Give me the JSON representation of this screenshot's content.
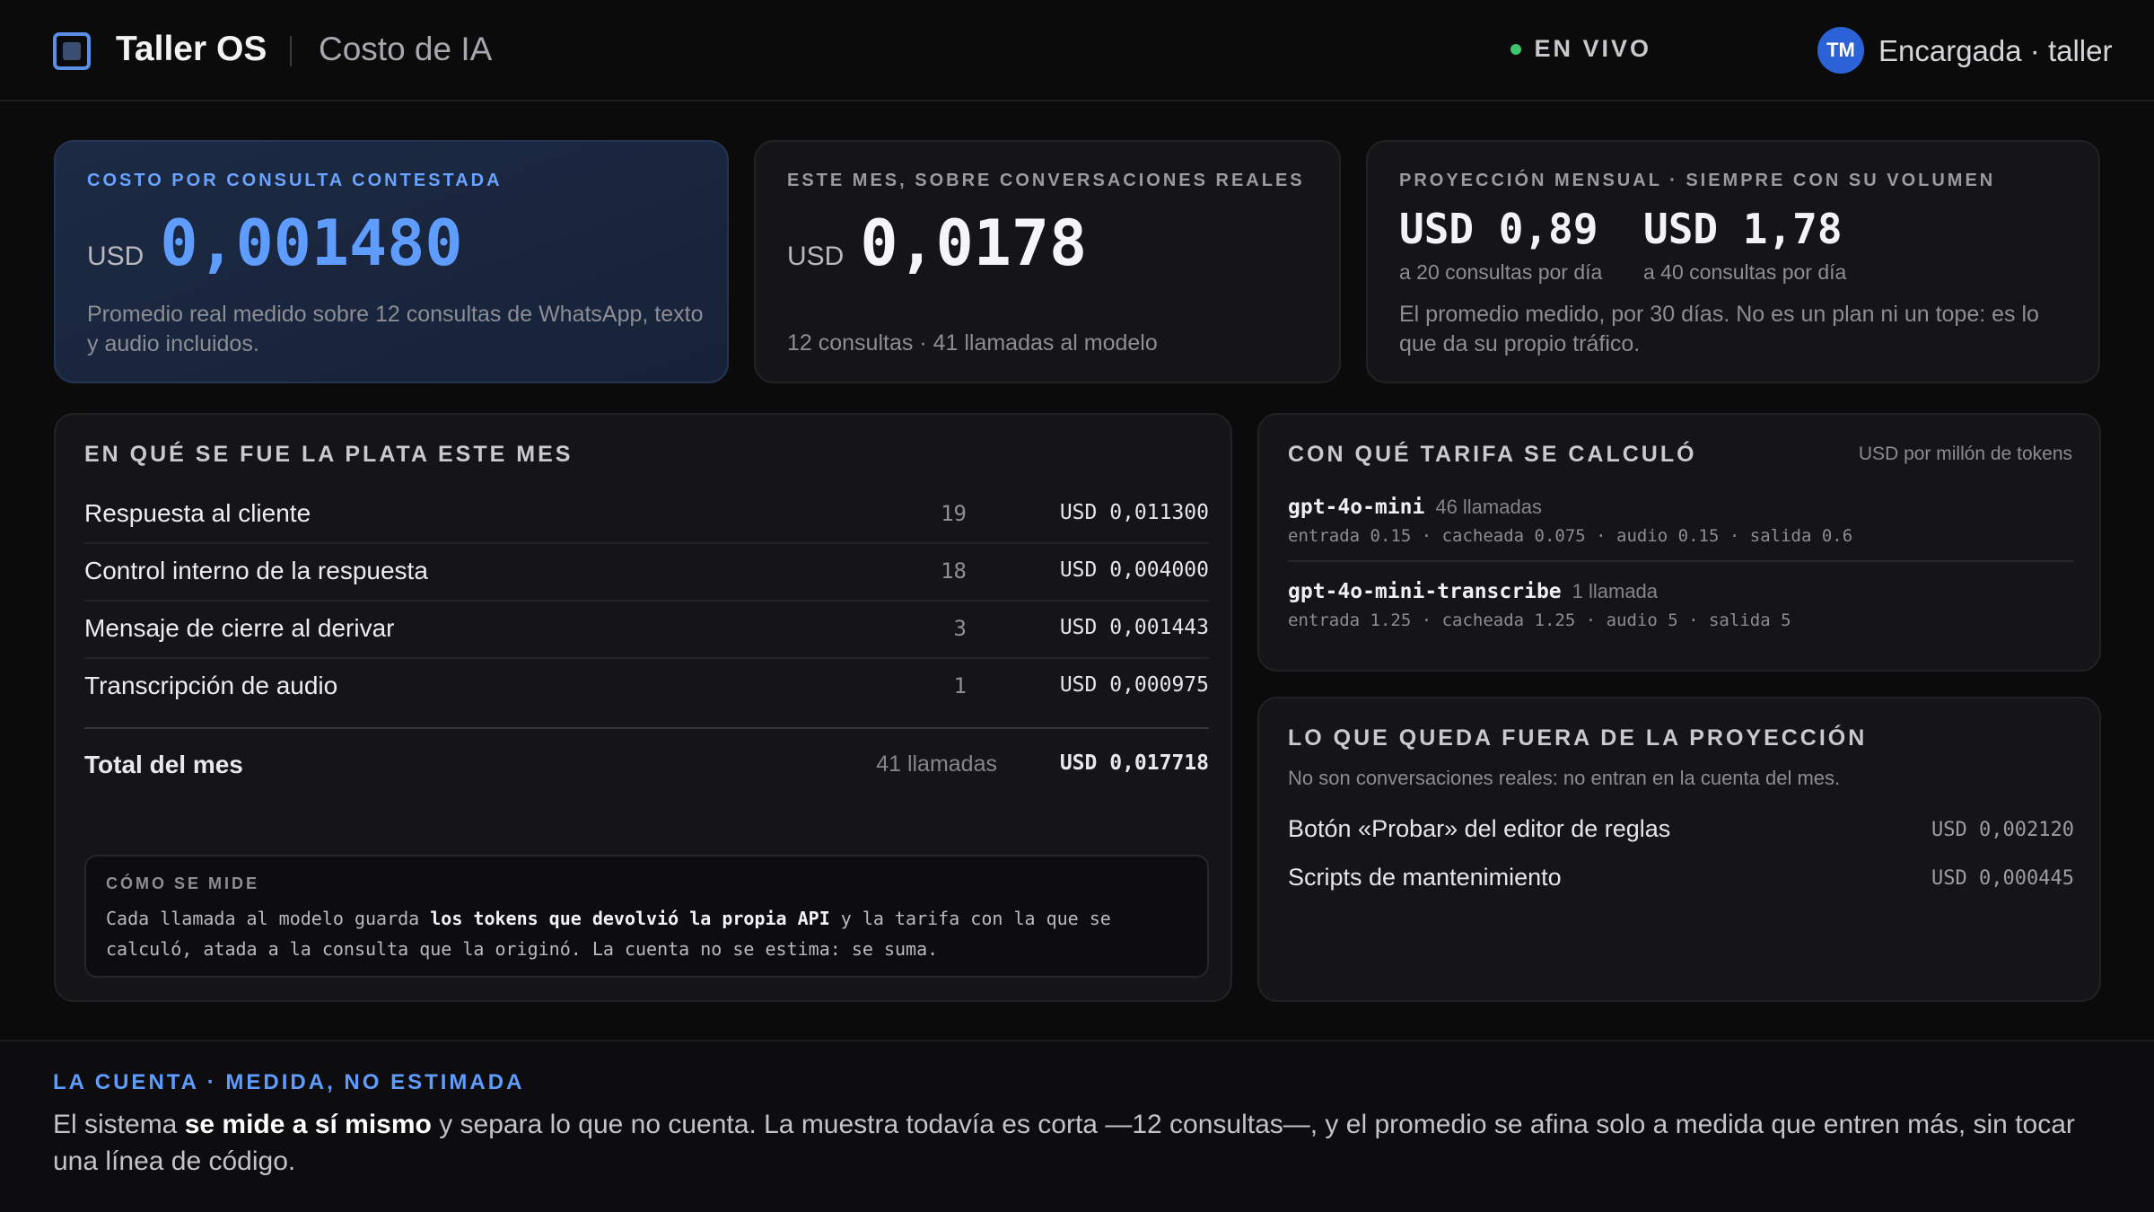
{
  "header": {
    "brand": "Taller OS",
    "section": "Costo de IA",
    "live": "EN VIVO",
    "avatar_initials": "TM",
    "user": "Encargada · taller"
  },
  "stats": [
    {
      "kicker": "COSTO POR CONSULTA CONTESTADA",
      "currency": "USD",
      "value": "0,001480",
      "desc": "Promedio real medido sobre 12 consultas de WhatsApp, texto y audio incluidos."
    },
    {
      "kicker": "ESTE MES, SOBRE CONVERSACIONES REALES",
      "currency": "USD",
      "value": "0,0178",
      "desc": "12 consultas · 41 llamadas al modelo"
    },
    {
      "kicker": "PROYECCIÓN MENSUAL · SIEMPRE CON SU VOLUMEN",
      "proj_a_value": "USD 0,89",
      "proj_a_label": "a 20 consultas por día",
      "proj_b_value": "USD 1,78",
      "proj_b_label": "a 40 consultas por día",
      "desc": "El promedio medido, por 30 días. No es un plan ni un tope: es lo que da su propio tráfico."
    }
  ],
  "breakdown": {
    "title": "EN QUÉ SE FUE LA PLATA ESTE MES",
    "rows": [
      {
        "label": "Respuesta al cliente",
        "count": "19",
        "amount": "USD 0,011300"
      },
      {
        "label": "Control interno de la respuesta",
        "count": "18",
        "amount": "USD 0,004000"
      },
      {
        "label": "Mensaje de cierre al derivar",
        "count": "3",
        "amount": "USD 0,001443"
      },
      {
        "label": "Transcripción de audio",
        "count": "1",
        "amount": "USD 0,000975"
      }
    ],
    "total": {
      "label": "Total del mes",
      "count": "41 llamadas",
      "amount": "USD 0,017718"
    },
    "how": {
      "kicker": "CÓMO SE MIDE",
      "pre": "Cada llamada al modelo guarda ",
      "strong": "los tokens que devolvió la propia API",
      "post": " y la tarifa con la que se calculó, atada a la consulta que la originó. La cuenta no se estima: se suma."
    }
  },
  "tariff": {
    "title": "CON QUÉ TARIFA SE CALCULÓ",
    "unit": "USD por millón de tokens",
    "models": [
      {
        "name": "gpt-4o-mini",
        "calls": "46 llamadas",
        "rates": "entrada 0.15 · cacheada 0.075 · audio 0.15 · salida 0.6"
      },
      {
        "name": "gpt-4o-mini-transcribe",
        "calls": "1 llamada",
        "rates": "entrada 1.25 · cacheada 1.25 · audio 5 · salida 5"
      }
    ]
  },
  "outside": {
    "title": "LO QUE QUEDA FUERA DE LA PROYECCIÓN",
    "subtitle": "No son conversaciones reales: no entran en la cuenta del mes.",
    "rows": [
      {
        "label": "Botón «Probar» del editor de reglas",
        "amount": "USD 0,002120"
      },
      {
        "label": "Scripts de mantenimiento",
        "amount": "USD 0,000445"
      }
    ]
  },
  "footer": {
    "kicker": "LA CUENTA · MEDIDA, NO ESTIMADA",
    "pre": "El sistema ",
    "strong": "se mide a sí mismo",
    "post": " y separa lo que no cuenta. La muestra todavía es corta —12 consultas—, y el promedio se afina solo a medida que entren más, sin tocar una línea de código."
  },
  "colors": {
    "accent": "#5f9cff",
    "live_dot": "#3ec46d",
    "avatar": "#2c62d8",
    "background": "#0b0b0c"
  }
}
